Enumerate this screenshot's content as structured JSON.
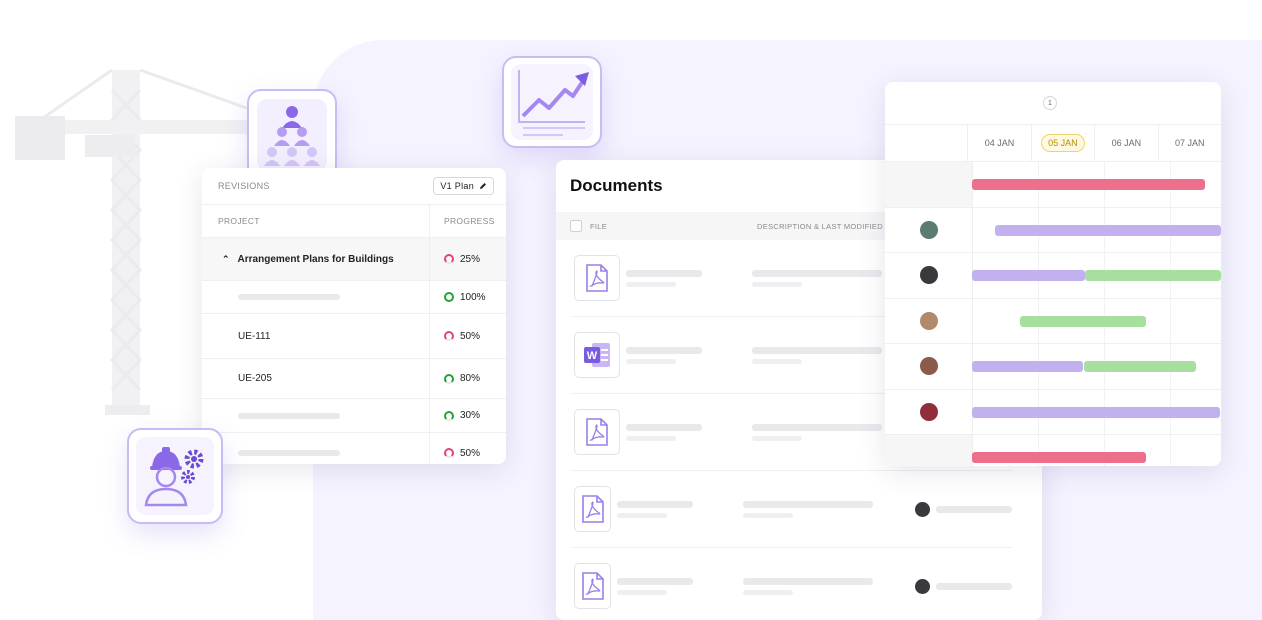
{
  "revisions": {
    "label": "REVISIONS",
    "plan_label": "V1 Plan",
    "columns": [
      "PROJECT",
      "PROGRESS"
    ],
    "rows": [
      {
        "name": "Arrangement Plans for Buildings",
        "progress": "25%",
        "color": "#e2476b",
        "selected": true
      },
      {
        "name": "",
        "progress": "100%",
        "color": "#22a33a"
      },
      {
        "name": "UE-111",
        "progress": "50%",
        "color": "#e2476b"
      },
      {
        "name": "UE-205",
        "progress": "80%",
        "color": "#22a33a"
      },
      {
        "name": "",
        "progress": "30%",
        "color": "#22a33a"
      },
      {
        "name": "",
        "progress": "50%",
        "color": "#e2476b"
      }
    ]
  },
  "documents": {
    "title": "Documents",
    "columns": [
      "FILE",
      "DESCRIPTION & LAST MODIFIED"
    ],
    "files": [
      "pdf",
      "word",
      "pdf",
      "pdf",
      "pdf"
    ]
  },
  "gantt": {
    "counter": "1",
    "dates": [
      "04 JAN",
      "05 JAN",
      "06 JAN",
      "07 JAN"
    ],
    "highlight_date": "05 JAN"
  },
  "colors": {
    "accent": "#7b5ce0",
    "pink": "#ec6f8c",
    "purple": "#c2b0ef",
    "green": "#a6df9e"
  },
  "icons": [
    "team-hierarchy-icon",
    "growth-chart-icon",
    "engineer-gears-icon",
    "pdf-file-icon",
    "word-file-icon"
  ]
}
